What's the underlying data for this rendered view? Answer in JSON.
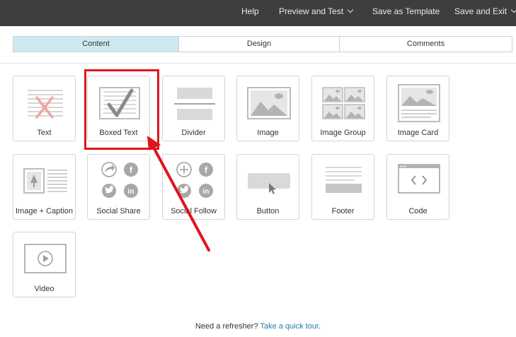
{
  "topbar": {
    "help": "Help",
    "preview": "Preview and Test",
    "save_template": "Save as Template",
    "save_exit": "Save and Exit"
  },
  "tabs": [
    {
      "label": "Content",
      "active": true
    },
    {
      "label": "Design",
      "active": false
    },
    {
      "label": "Comments",
      "active": false
    }
  ],
  "blocks": [
    {
      "label": "Text",
      "icon": "text-block-icon"
    },
    {
      "label": "Boxed Text",
      "icon": "boxed-text-block-icon"
    },
    {
      "label": "Divider",
      "icon": "divider-block-icon"
    },
    {
      "label": "Image",
      "icon": "image-block-icon"
    },
    {
      "label": "Image Group",
      "icon": "image-group-block-icon"
    },
    {
      "label": "Image Card",
      "icon": "image-card-block-icon"
    },
    {
      "label": "Image + Caption",
      "icon": "image-caption-block-icon"
    },
    {
      "label": "Social Share",
      "icon": "social-share-block-icon"
    },
    {
      "label": "Social Follow",
      "icon": "social-follow-block-icon"
    },
    {
      "label": "Button",
      "icon": "button-block-icon"
    },
    {
      "label": "Footer",
      "icon": "footer-block-icon"
    },
    {
      "label": "Code",
      "icon": "code-block-icon"
    },
    {
      "label": "Video",
      "icon": "video-block-icon"
    }
  ],
  "annotation": {
    "color": "#e0151c"
  },
  "footer": {
    "prefix": "Need a refresher?",
    "link": "Take a quick tour",
    "suffix": "."
  }
}
